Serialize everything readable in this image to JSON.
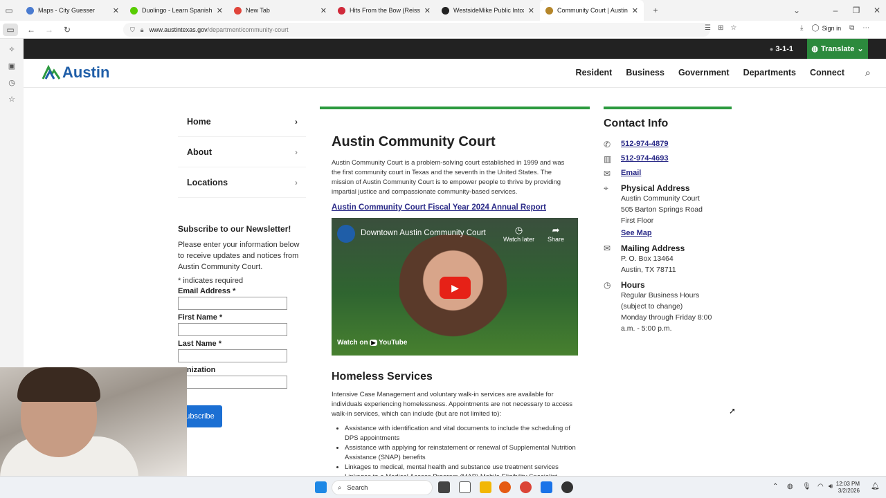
{
  "browser": {
    "tabs": [
      {
        "title": "Maps - City Guesser",
        "color": "#4a7bd0"
      },
      {
        "title": "Duolingo - Learn Spanish with D",
        "color": "#58cc02"
      },
      {
        "title": "New Tab",
        "color": "#e0443a"
      },
      {
        "title": "Hits From the Bow (Reissue) - A",
        "color": "#d0293a"
      },
      {
        "title": "WestsideMike Public Intoxicatio",
        "color": "#222222"
      },
      {
        "title": "Community Court | AustinTexas",
        "color": "#b5862a",
        "active": true
      }
    ],
    "url_prefix": "www.austintexas.gov",
    "url_path": "/department/community-court",
    "sign_in": "Sign in"
  },
  "site": {
    "call_number": "3-1-1",
    "translate": "Translate",
    "logo_text": "Austin",
    "nav": [
      "Resident",
      "Business",
      "Government",
      "Departments",
      "Connect"
    ]
  },
  "sidenav": [
    "Home",
    "About",
    "Locations"
  ],
  "newsletter": {
    "title": "Subscribe to our Newsletter!",
    "desc": "Please enter your information below to receive updates and notices from Austin Community Court.",
    "required_note": "* indicates required",
    "email_label": "Email Address *",
    "first_label": "First Name *",
    "last_label": "Last Name *",
    "org_label": "ganization",
    "button": "ubscribe"
  },
  "main": {
    "title": "Austin Community Court",
    "intro": "Austin Community Court is a problem-solving court established in 1999 and was the first community court in Texas and the seventh in the United States. The mission of Austin Community Court is to empower people to thrive by providing impartial justice and compassionate community-based services.",
    "report_link": "Austin Community Court Fiscal Year 2024 Annual Report",
    "video": {
      "title": "Downtown Austin Community Court",
      "watch_later": "Watch later",
      "share": "Share",
      "watch_on": "Watch on",
      "youtube": "YouTube"
    },
    "homeless_title": "Homeless Services",
    "homeless_desc": "Intensive Case Management and voluntary walk-in services are available for individuals experiencing homelessness.  Appointments are not necessary to access walk-in services, which can include (but are not limited to):",
    "homeless_list": [
      "Assistance with identification and vital documents to include the scheduling of DPS appointments",
      "Assistance with applying for reinstatement or renewal of Supplemental Nutrition Assistance (SNAP) benefits",
      "Linkages to medical, mental health and substance use treatment services",
      "Linkages to a Medical Access Program (MAP) Mobile Eligibility Specialist"
    ]
  },
  "contact": {
    "title": "Contact Info",
    "phone": "512-974-4879",
    "fax": "512-974-4693",
    "email": "Email",
    "physical_head": "Physical Address",
    "physical_lines": [
      "Austin Community Court",
      "505 Barton Springs Road",
      "First Floor"
    ],
    "see_map": "See Map",
    "mailing_head": "Mailing Address",
    "mailing_lines": [
      "P. O. Box 13464",
      "Austin, TX 78711"
    ],
    "hours_head": "Hours",
    "hours_lines": [
      "Regular Business Hours",
      "(subject to change)",
      "Monday through Friday 8:00",
      "a.m. - 5:00 p.m."
    ]
  },
  "taskbar": {
    "search": "Search",
    "time": "12:03 PM",
    "date": "3/2/2026"
  }
}
